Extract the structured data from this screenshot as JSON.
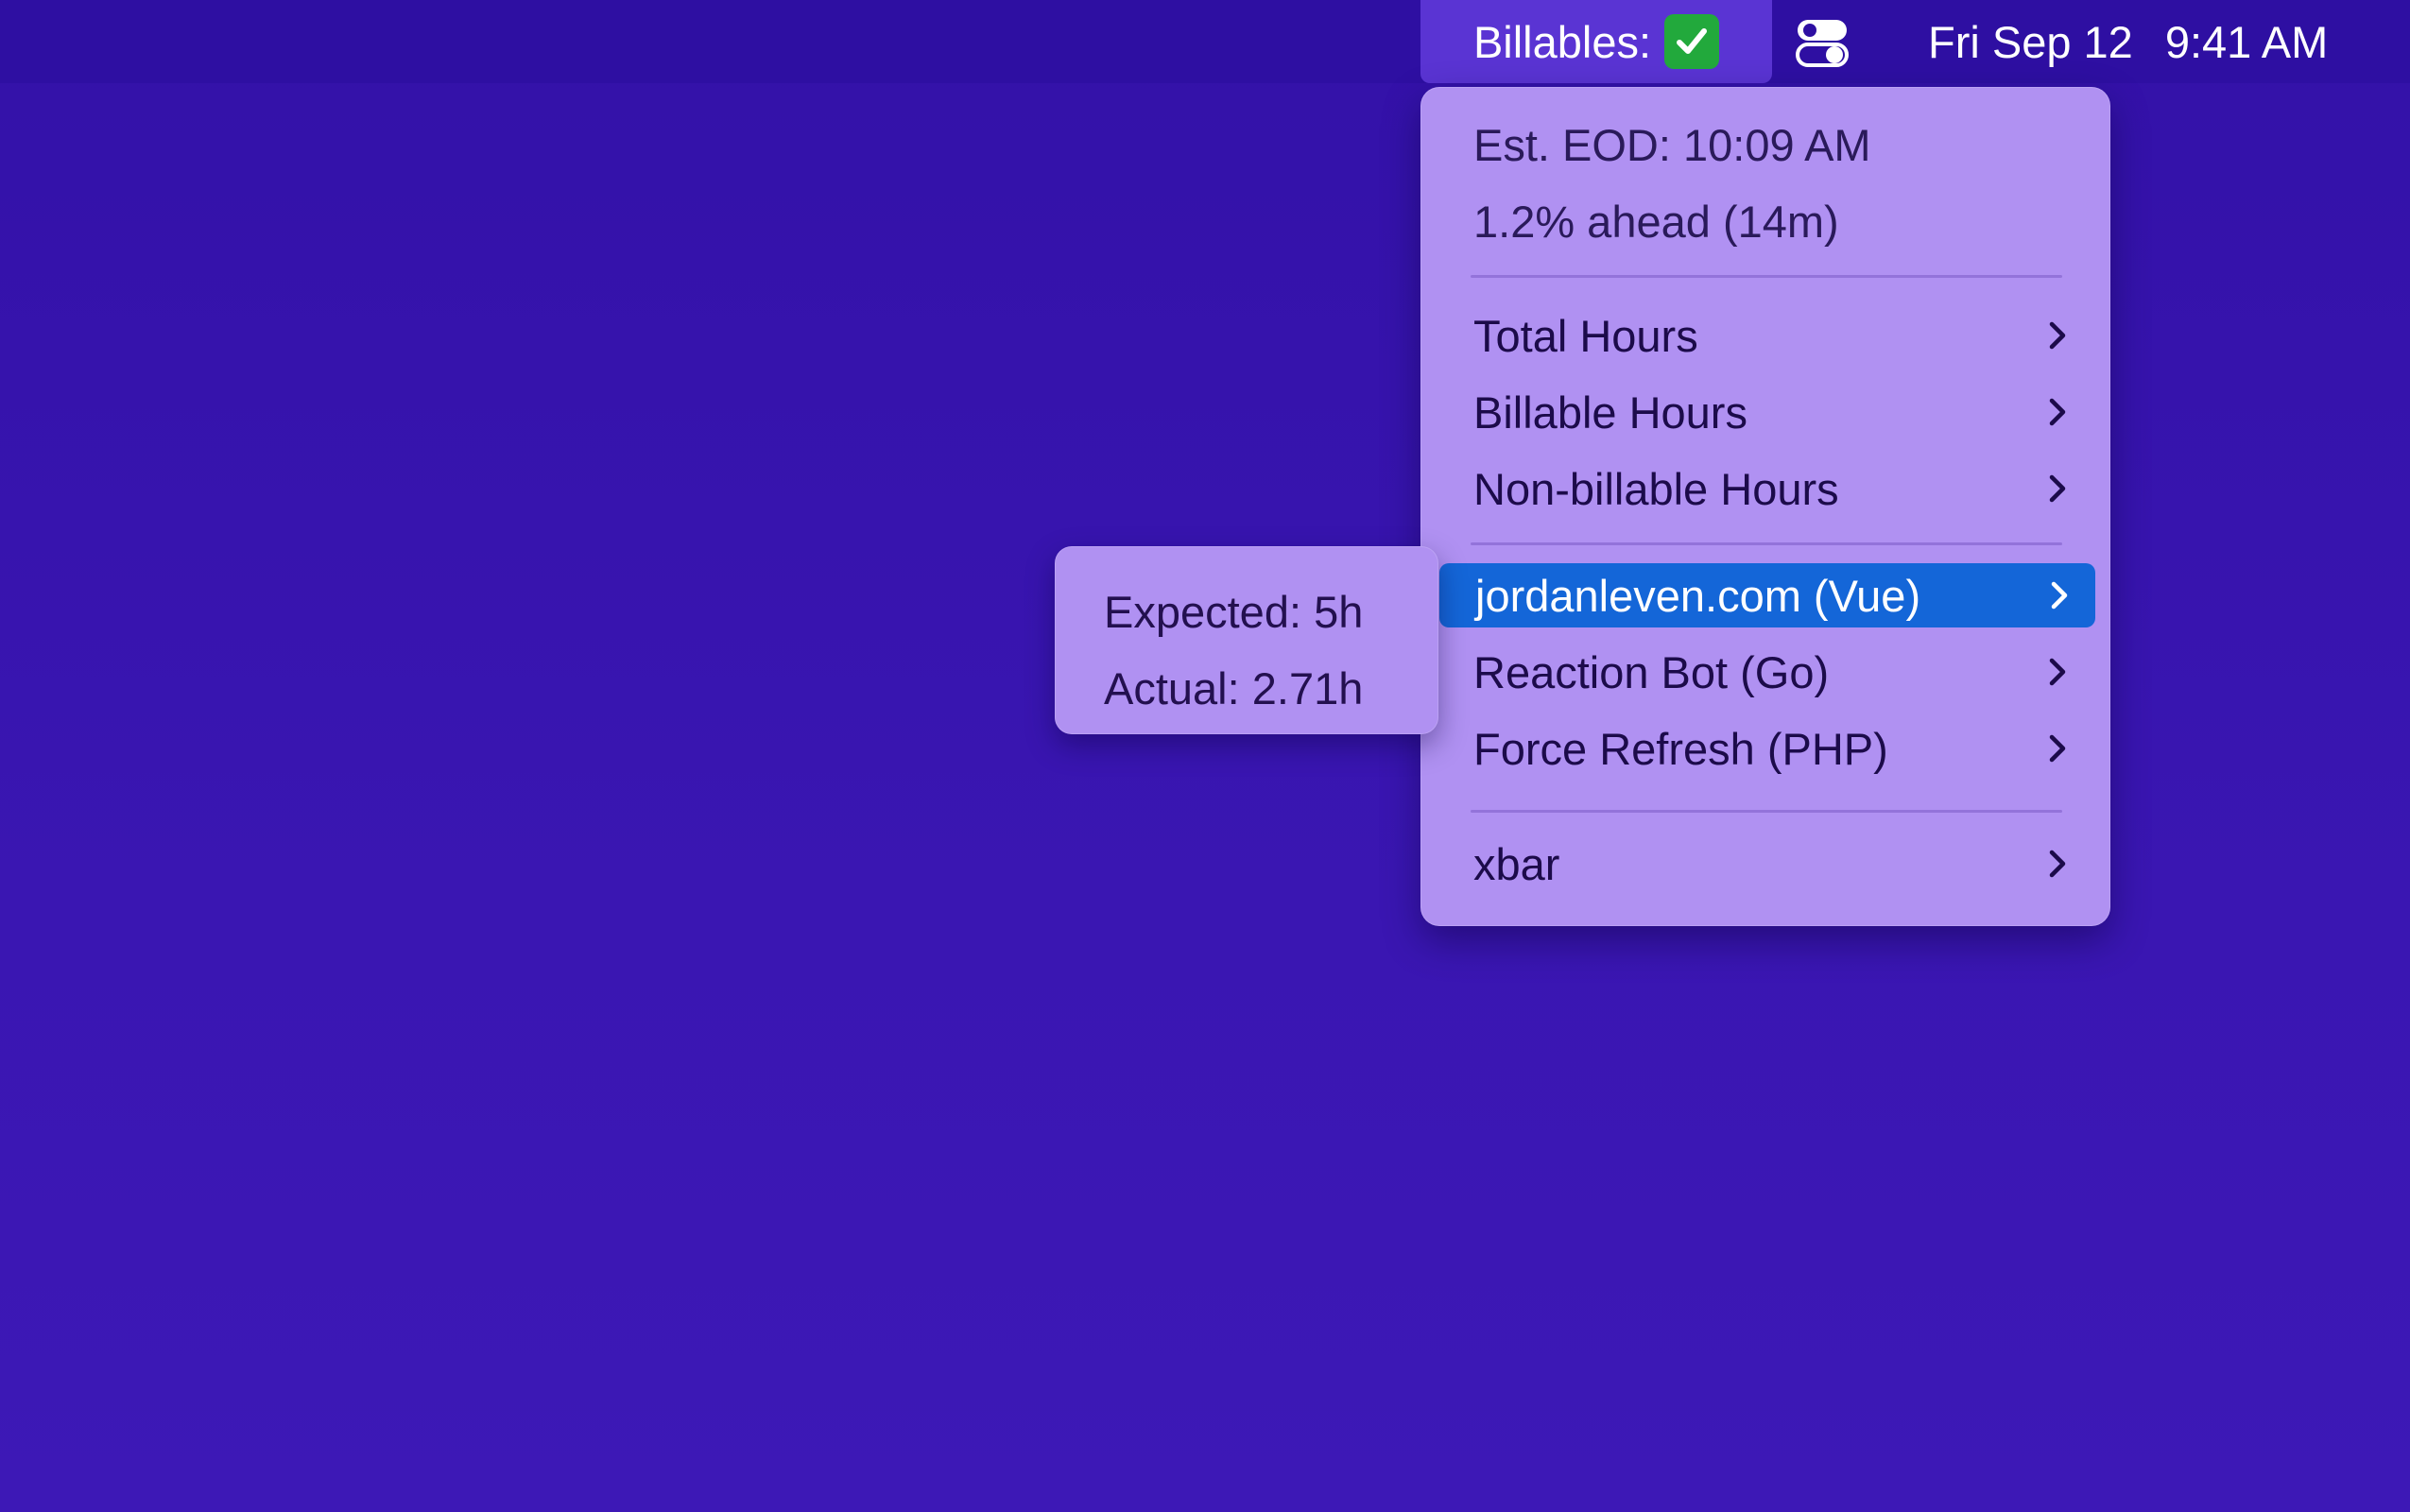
{
  "menubar": {
    "app_label": "Billables:",
    "status_icon": "check-mark-icon",
    "control_icon": "toggle-switches-icon",
    "date": "Fri Sep 12",
    "time": "9:41 AM"
  },
  "menu": {
    "info": {
      "eod": "Est. EOD: 10:09 AM",
      "ahead": "1.2% ahead (14m)"
    },
    "hours_items": [
      {
        "label": "Total Hours"
      },
      {
        "label": "Billable Hours"
      },
      {
        "label": "Non-billable Hours"
      }
    ],
    "project_items": [
      {
        "label": "jordanleven.com (Vue)",
        "highlighted": true
      },
      {
        "label": "Reaction Bot (Go)",
        "highlighted": false
      },
      {
        "label": "Force Refresh (PHP)",
        "highlighted": false
      }
    ],
    "footer_items": [
      {
        "label": "xbar"
      }
    ]
  },
  "submenu": {
    "expected": "Expected: 5h",
    "actual": "Actual: 2.71h"
  },
  "colors": {
    "desktop": "#3a16b2",
    "menubar": "#2e0fa2",
    "menu_background": "#b091f2",
    "highlight": "#1466d8",
    "check_green": "#22a93c"
  }
}
